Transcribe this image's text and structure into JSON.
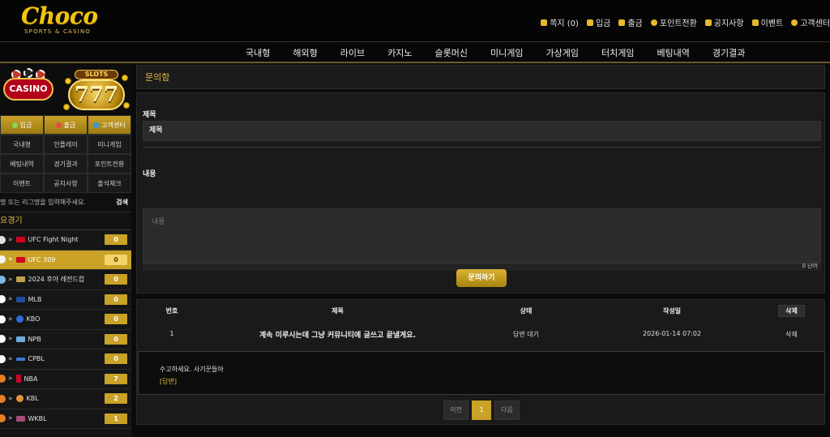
{
  "brand": {
    "name": "Choco",
    "tagline": "SPORTS & CASINO"
  },
  "top_menu": [
    {
      "label": "쪽지 (0)",
      "icon": "mail-icon"
    },
    {
      "label": "입금",
      "icon": "wallet-icon"
    },
    {
      "label": "출금",
      "icon": "bag-icon"
    },
    {
      "label": "포인트전환",
      "icon": "point-icon"
    },
    {
      "label": "공지사항",
      "icon": "bell-icon"
    },
    {
      "label": "이벤트",
      "icon": "gift-icon"
    },
    {
      "label": "고객센터",
      "icon": "headset-icon"
    }
  ],
  "nav": [
    "국내형",
    "해외형",
    "라이브",
    "카지노",
    "슬롯머신",
    "미니게임",
    "가상게임",
    "터치게임",
    "베팅내역",
    "경기결과"
  ],
  "sidebar": {
    "banner": {
      "casino_label": "CASINO",
      "slots_label": "SLOTS",
      "slots_number": "777"
    },
    "quick_buttons": [
      {
        "label": "입금",
        "gold": true,
        "dot_color": "#7ed957"
      },
      {
        "label": "출금",
        "gold": true,
        "dot_color": "#e74c3c"
      },
      {
        "label": "고객센터",
        "gold": true,
        "dot_color": "#3498db"
      },
      {
        "label": "국내형",
        "gold": false
      },
      {
        "label": "인플레이",
        "gold": false
      },
      {
        "label": "미니게임",
        "gold": false
      },
      {
        "label": "베팅내역",
        "gold": false
      },
      {
        "label": "경기결과",
        "gold": false
      },
      {
        "label": "포인트전환",
        "gold": false
      },
      {
        "label": "이벤트",
        "gold": false
      },
      {
        "label": "공지사항",
        "gold": false
      },
      {
        "label": "출석체크",
        "gold": false
      }
    ],
    "search": {
      "placeholder": "명 또는 리그명을 입력해주세요.",
      "button": "검색"
    },
    "major_title": "요경기",
    "leagues": [
      {
        "name": "UFC Fight Night",
        "count": "0",
        "active": false,
        "logo_color": "#d0021b"
      },
      {
        "name": "UFC 309",
        "count": "0",
        "active": true,
        "logo_color": "#d0021b"
      },
      {
        "name": "2024 후야 레전드컵",
        "count": "0",
        "active": false,
        "logo_color": "#c0a050"
      },
      {
        "name": "MLB",
        "count": "0",
        "active": false,
        "logo_color": "#1f4e9c"
      },
      {
        "name": "KBO",
        "count": "0",
        "active": false,
        "logo_color": "#2d6cdf"
      },
      {
        "name": "NPB",
        "count": "0",
        "active": false,
        "logo_color": "#6fa8dc"
      },
      {
        "name": "CPBL",
        "count": "0",
        "active": false,
        "logo_color": "#3c78d8"
      },
      {
        "name": "NBA",
        "count": "7",
        "active": false,
        "logo_color": "#c9082a"
      },
      {
        "name": "KBL",
        "count": "2",
        "active": false,
        "logo_color": "#e69138"
      },
      {
        "name": "WKBL",
        "count": "1",
        "active": false,
        "logo_color": "#a64d79"
      }
    ]
  },
  "main": {
    "title": "문의함",
    "form": {
      "title_label": "제목",
      "title_value": "제목",
      "content_label": "내용",
      "content_placeholder": "내용",
      "char_count": "0 단어",
      "submit": "문의하기"
    },
    "table": {
      "headers": {
        "no": "번호",
        "title": "제목",
        "status": "상태",
        "date": "작성일",
        "delete": "삭제"
      },
      "rows": [
        {
          "no": "1",
          "title": "계속 미루시는데 그냥 커뮤니티에 글쓰고 끝낼게요.",
          "status": "답변 대기",
          "date": "2026-01-14 07:02",
          "delete": "삭제"
        }
      ],
      "answer": {
        "text": "수고하세요. 사기꾼들아",
        "tag": "[답변]"
      }
    },
    "pagination": {
      "prev": "이전",
      "current": "1",
      "next": "다음"
    }
  },
  "colors": {
    "accent": "#c9a227",
    "gold_text": "#e2b93b",
    "background": "#0b0b0b"
  }
}
